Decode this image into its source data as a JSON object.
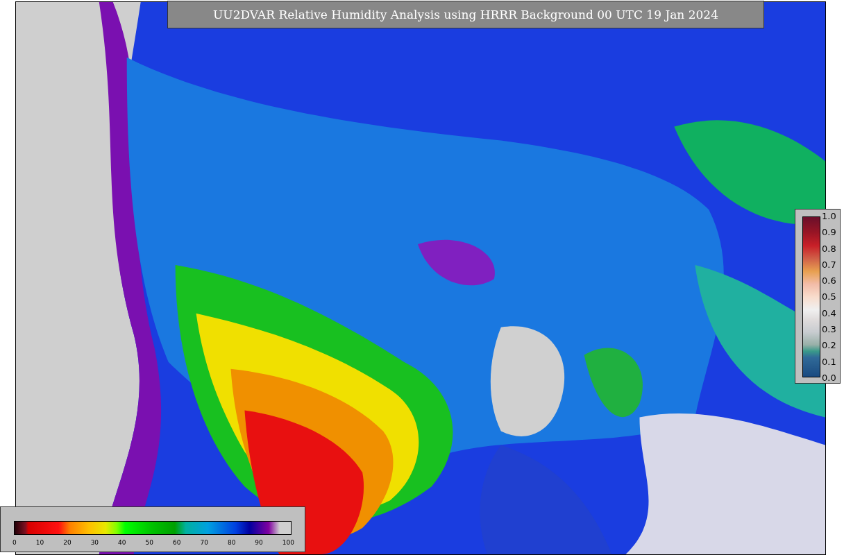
{
  "title": "UU2DVAR Relative Humidity Analysis using HRRR Background 00 UTC 19 Jan 2024",
  "observation_legend": {
    "labels": [
      "1.0",
      "0.9",
      "0.8",
      "0.7",
      "0.6",
      "0.5",
      "0.4",
      "0.3",
      "0.2",
      "0.1",
      "0.0"
    ]
  },
  "humidity_legend": {
    "labels": [
      "0",
      "10",
      "20",
      "30",
      "40",
      "50",
      "60",
      "70",
      "80",
      "90",
      "100"
    ]
  }
}
